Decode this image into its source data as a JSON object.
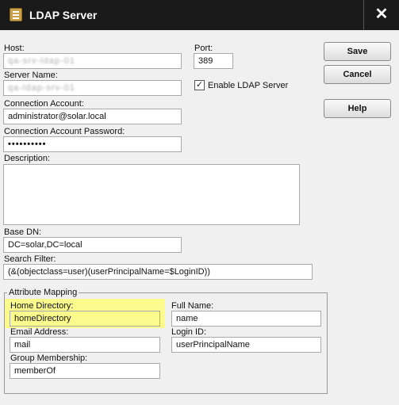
{
  "window": {
    "title": "LDAP Server",
    "close_glyph": "✕"
  },
  "form": {
    "host": {
      "label": "Host:",
      "value": "qa-srv-ldap-01"
    },
    "port": {
      "label": "Port:",
      "value": "389"
    },
    "server_name": {
      "label": "Server Name:",
      "value": "qa-ldap-srv-01"
    },
    "enable_ldap": {
      "label": "Enable LDAP Server",
      "checked": true
    },
    "connection_account": {
      "label": "Connection Account:",
      "value": "administrator@solar.local"
    },
    "connection_password": {
      "label": "Connection Account Password:",
      "value": "••••••••••"
    },
    "description": {
      "label": "Description:",
      "value": ""
    },
    "base_dn": {
      "label": "Base DN:",
      "value": "DC=solar,DC=local"
    },
    "search_filter": {
      "label": "Search Filter:",
      "value": "(&(objectclass=user)(userPrincipalName=$LoginID))"
    }
  },
  "attribute_mapping": {
    "title": "Attribute Mapping",
    "home_directory": {
      "label": "Home Directory:",
      "value": "homeDirectory"
    },
    "full_name": {
      "label": "Full Name:",
      "value": "name"
    },
    "email_address": {
      "label": "Email Address:",
      "value": "mail"
    },
    "login_id": {
      "label": "Login ID:",
      "value": "userPrincipalName"
    },
    "group_membership": {
      "label": "Group Membership:",
      "value": "memberOf"
    }
  },
  "buttons": {
    "save": "Save",
    "cancel": "Cancel",
    "help": "Help"
  },
  "colors": {
    "titlebar": "#1a1a1a",
    "highlight": "#fbfa8c",
    "background": "#f0f0f0"
  },
  "icons": {
    "app": "ldap-server-icon",
    "close": "close-icon",
    "check": "checkmark-icon"
  }
}
